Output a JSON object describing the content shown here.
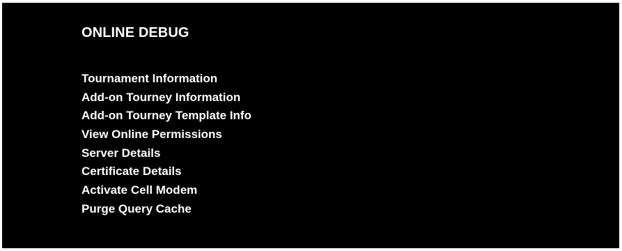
{
  "screen": {
    "title": "ONLINE DEBUG",
    "menu": {
      "items": [
        {
          "label": "Tournament Information"
        },
        {
          "label": "Add-on Tourney Information"
        },
        {
          "label": "Add-on Tourney Template Info"
        },
        {
          "label": "View Online Permissions"
        },
        {
          "label": "Server Details"
        },
        {
          "label": "Certificate Details"
        },
        {
          "label": "Activate Cell Modem"
        },
        {
          "label": "Purge Query Cache"
        }
      ]
    }
  },
  "colors": {
    "background": "#000000",
    "text": "#ffffff",
    "border": "#ffffff"
  }
}
